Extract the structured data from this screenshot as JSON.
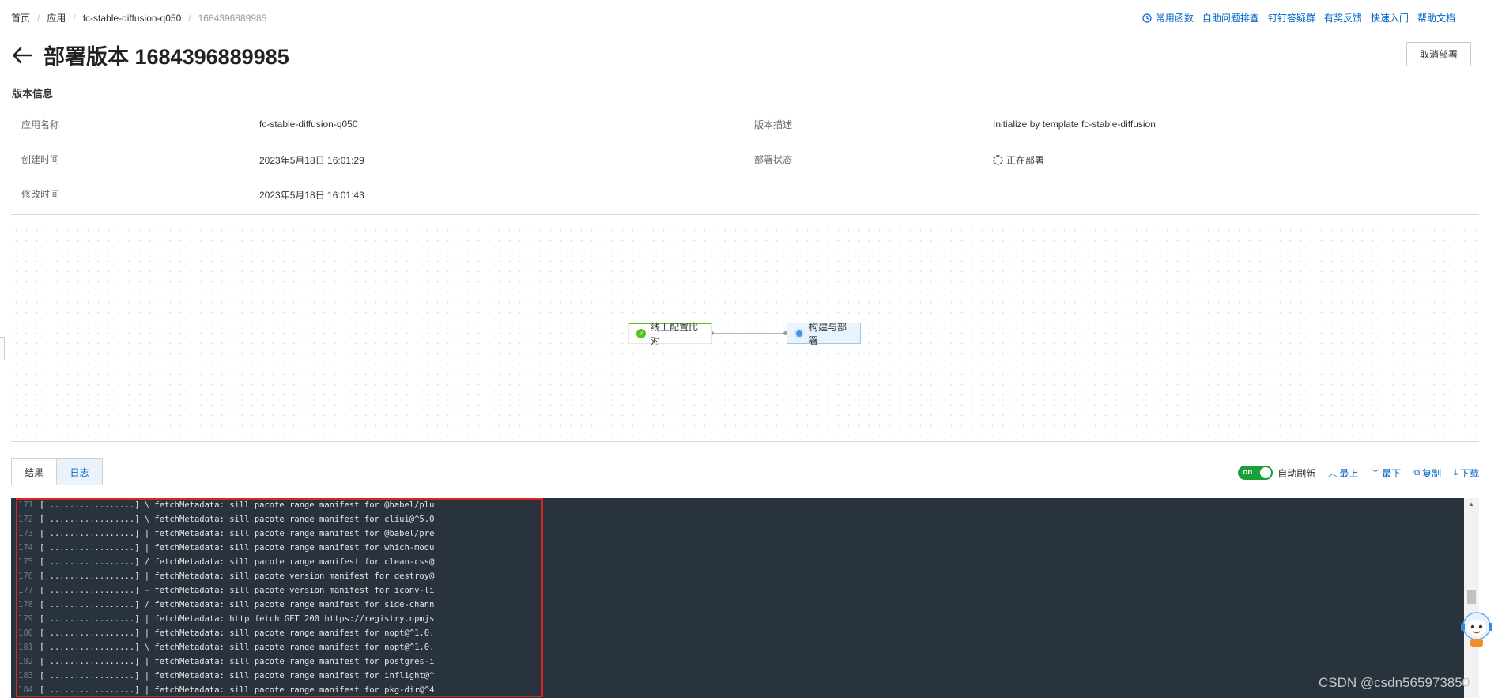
{
  "breadcrumb": {
    "items": [
      "首页",
      "应用",
      "fc-stable-diffusion-q050"
    ],
    "current": "1684396889985",
    "separator": "/"
  },
  "top_links": [
    "常用函数",
    "自助问题排查",
    "钉钉答疑群",
    "有奖反馈",
    "快速入门",
    "帮助文档"
  ],
  "header": {
    "title": "部署版本 1684396889985",
    "cancel_label": "取消部署"
  },
  "section": {
    "title": "版本信息"
  },
  "info": {
    "app_name_label": "应用名称",
    "app_name_value": "fc-stable-diffusion-q050",
    "created_label": "创建时间",
    "created_value": "2023年5月18日 16:01:29",
    "modified_label": "修改时间",
    "modified_value": "2023年5月18日 16:01:43",
    "desc_label": "版本描述",
    "desc_value": "Initialize by template fc-stable-diffusion",
    "status_label": "部署状态",
    "status_value": "正在部署"
  },
  "pipeline": {
    "node1_label": "线上配置比对",
    "node2_label": "构建与部署"
  },
  "tabs": [
    "结果",
    "日志"
  ],
  "log_toolbar": {
    "toggle_text": "on",
    "auto_refresh": "自动刷新",
    "top": "最上",
    "bottom": "最下",
    "copy": "复制",
    "download": "下载"
  },
  "log_lines": [
    {
      "n": "171",
      "t": "[ .................] \\ fetchMetadata: sill pacote range manifest for @babel/plu"
    },
    {
      "n": "172",
      "t": "[ .................] \\ fetchMetadata: sill pacote range manifest for cliui@^5.0"
    },
    {
      "n": "173",
      "t": "[ .................] | fetchMetadata: sill pacote range manifest for @babel/pre"
    },
    {
      "n": "174",
      "t": "[ .................] | fetchMetadata: sill pacote range manifest for which-modu"
    },
    {
      "n": "175",
      "t": "[ .................] / fetchMetadata: sill pacote range manifest for clean-css@"
    },
    {
      "n": "176",
      "t": "[ .................] | fetchMetadata: sill pacote version manifest for destroy@"
    },
    {
      "n": "177",
      "t": "[ .................] - fetchMetadata: sill pacote version manifest for iconv-li"
    },
    {
      "n": "178",
      "t": "[ .................] / fetchMetadata: sill pacote range manifest for side-chann"
    },
    {
      "n": "179",
      "t": "[ .................] | fetchMetadata: http fetch GET 200 https://registry.npmjs"
    },
    {
      "n": "180",
      "t": "[ .................] | fetchMetadata: sill pacote range manifest for nopt@^1.0."
    },
    {
      "n": "181",
      "t": "[ .................] \\ fetchMetadata: sill pacote range manifest for nopt@^1.0."
    },
    {
      "n": "182",
      "t": "[ .................] | fetchMetadata: sill pacote range manifest for postgres-i"
    },
    {
      "n": "183",
      "t": "[ .................] | fetchMetadata: sill pacote range manifest for inflight@^"
    },
    {
      "n": "184",
      "t": "[ .................] | fetchMetadata: sill pacote range manifest for pkg-dir@^4"
    }
  ],
  "watermark": "CSDN @csdn565973850",
  "colors": {
    "link": "#0064c8",
    "success": "#52c41a",
    "toggle_on": "#1a9f3a",
    "log_bg": "#28333e",
    "highlight": "#e0231e"
  },
  "icons": [
    "back-arrow-icon",
    "clock-icon",
    "check-circle-icon",
    "running-dot-icon",
    "spinner-icon",
    "chevron-up-icon",
    "chevron-down-icon",
    "copy-icon",
    "download-icon",
    "assistant-icon"
  ]
}
